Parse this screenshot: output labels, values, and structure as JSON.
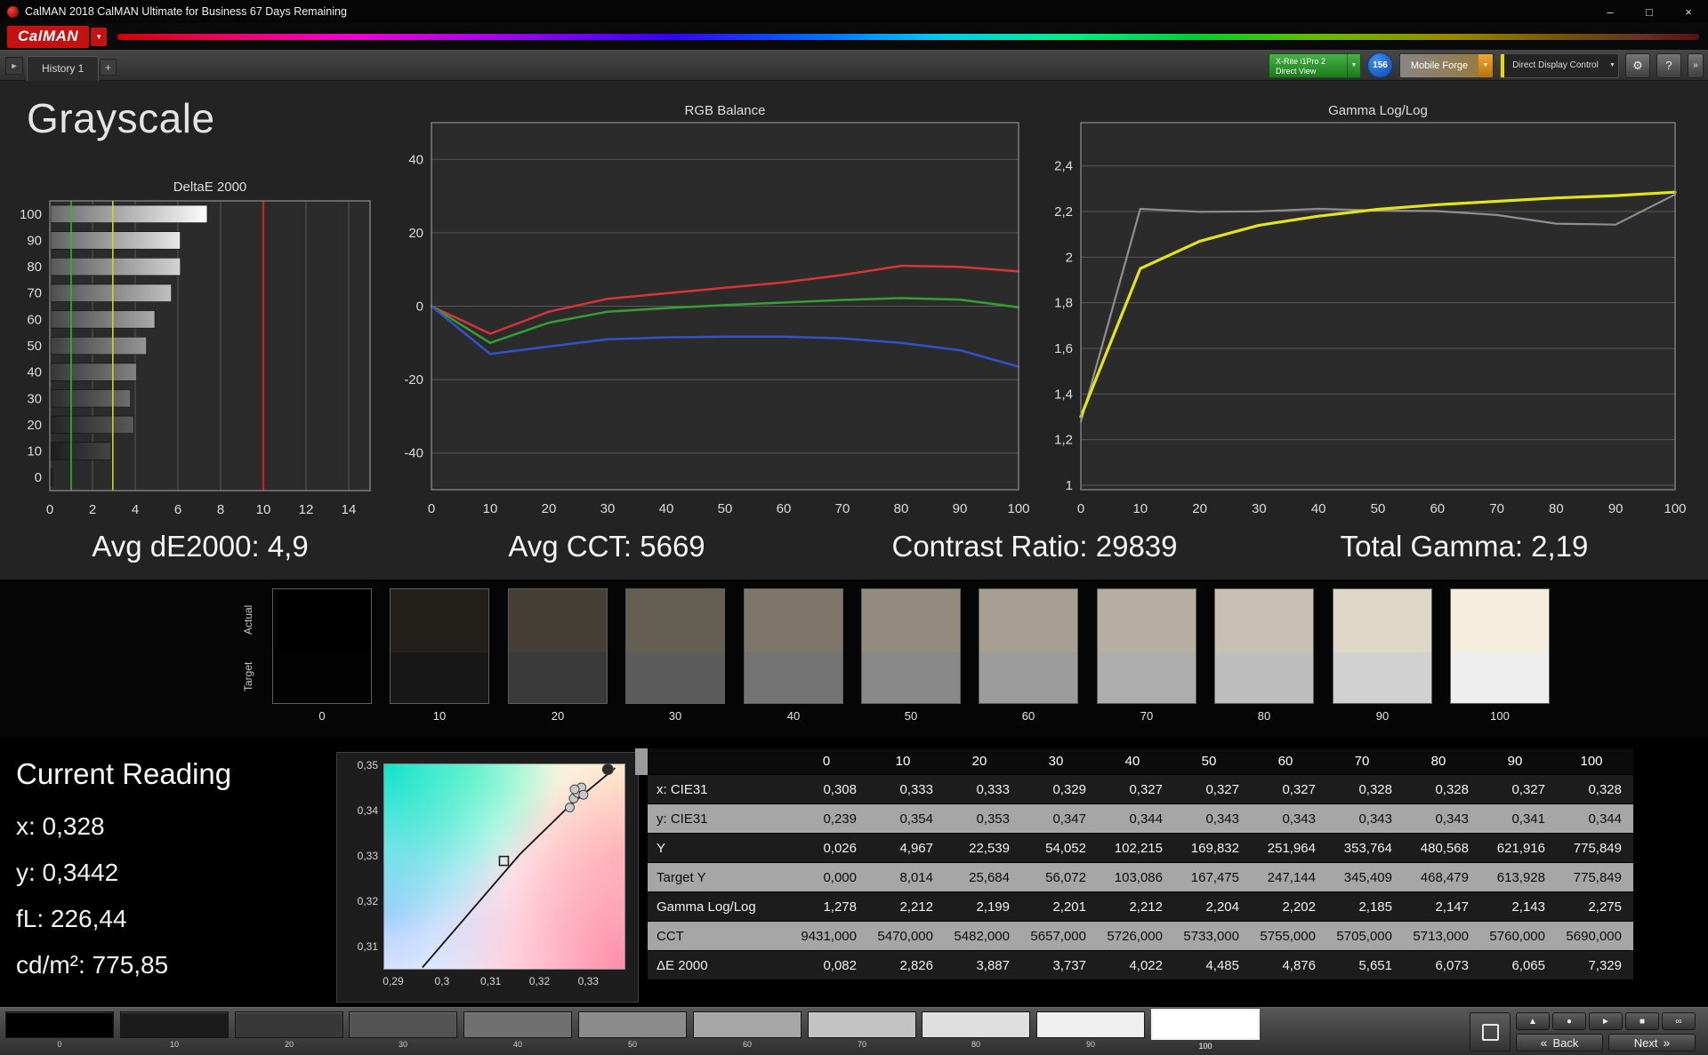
{
  "window": {
    "title": "CalMAN 2018 CalMAN Ultimate for Business 67 Days Remaining"
  },
  "icons": {
    "dropdown": "▼",
    "logo_arrow": "▼",
    "minimize": "–",
    "maximize": "□",
    "close": "×",
    "gear": "⚙",
    "help": "?",
    "plus": "+",
    "tab_nav": "►",
    "back_arrow": "«",
    "next_arrow": "»",
    "eject": "▲",
    "record": "●",
    "play": "►",
    "save": "■",
    "loop": "∞"
  },
  "logo": {
    "text": "CalMAN"
  },
  "toolbar": {
    "history_tab": "History 1",
    "meter_line1": "X-Rite i1Pro 2",
    "meter_line2": "Direct View",
    "badge": "156",
    "workflow": "Mobile Forge",
    "display_control": "Direct Display Control"
  },
  "page": {
    "title": "Grayscale"
  },
  "stats": [
    "Avg dE2000: 4,9",
    "Avg CCT: 5669",
    "Contrast Ratio: 29839",
    "Total Gamma: 2,19"
  ],
  "grayscale_patches": {
    "actual_label": "Actual",
    "target_label": "Target",
    "items": [
      {
        "label": "0",
        "actual": "#000000",
        "target": "#030303"
      },
      {
        "label": "10",
        "actual": "#231f1a",
        "target": "#181818"
      },
      {
        "label": "20",
        "actual": "#453f36",
        "target": "#3a3a3a"
      },
      {
        "label": "30",
        "actual": "#655e52",
        "target": "#5c5c5c"
      },
      {
        "label": "40",
        "actual": "#7d7669",
        "target": "#737373"
      },
      {
        "label": "50",
        "actual": "#948c7f",
        "target": "#898989"
      },
      {
        "label": "60",
        "actual": "#a69e91",
        "target": "#9c9c9c"
      },
      {
        "label": "70",
        "actual": "#b7afa2",
        "target": "#adadad"
      },
      {
        "label": "80",
        "actual": "#c8c0b3",
        "target": "#bebebe"
      },
      {
        "label": "90",
        "actual": "#ded6c7",
        "target": "#d1d1d1"
      },
      {
        "label": "100",
        "actual": "#f6eedd",
        "target": "#eeeeee"
      }
    ]
  },
  "current_reading": {
    "title": "Current Reading",
    "lines": [
      "x: 0,328",
      "y: 0,3442",
      "fL: 226,44",
      "cd/m²: 775,85"
    ]
  },
  "table": {
    "columns": [
      "0",
      "10",
      "20",
      "30",
      "40",
      "50",
      "60",
      "70",
      "80",
      "90",
      "100"
    ],
    "rows": [
      {
        "label": "x: CIE31",
        "light": false,
        "values": [
          "0,308",
          "0,333",
          "0,333",
          "0,329",
          "0,327",
          "0,327",
          "0,327",
          "0,328",
          "0,328",
          "0,327",
          "0,328"
        ]
      },
      {
        "label": "y: CIE31",
        "light": true,
        "values": [
          "0,239",
          "0,354",
          "0,353",
          "0,347",
          "0,344",
          "0,343",
          "0,343",
          "0,343",
          "0,343",
          "0,341",
          "0,344"
        ]
      },
      {
        "label": "Y",
        "light": false,
        "values": [
          "0,026",
          "4,967",
          "22,539",
          "54,052",
          "102,215",
          "169,832",
          "251,964",
          "353,764",
          "480,568",
          "621,916",
          "775,849"
        ]
      },
      {
        "label": "Target Y",
        "light": true,
        "values": [
          "0,000",
          "8,014",
          "25,684",
          "56,072",
          "103,086",
          "167,475",
          "247,144",
          "345,409",
          "468,479",
          "613,928",
          "775,849"
        ]
      },
      {
        "label": "Gamma Log/Log",
        "light": false,
        "values": [
          "1,278",
          "2,212",
          "2,199",
          "2,201",
          "2,212",
          "2,204",
          "2,202",
          "2,185",
          "2,147",
          "2,143",
          "2,275"
        ]
      },
      {
        "label": "CCT",
        "light": true,
        "values": [
          "9431,000",
          "5470,000",
          "5482,000",
          "5657,000",
          "5726,000",
          "5733,000",
          "5755,000",
          "5705,000",
          "5713,000",
          "5760,000",
          "5690,000"
        ]
      },
      {
        "label": "ΔE 2000",
        "light": false,
        "values": [
          "0,082",
          "2,826",
          "3,887",
          "3,737",
          "4,022",
          "4,485",
          "4,876",
          "5,651",
          "6,073",
          "6,065",
          "7,329"
        ]
      }
    ]
  },
  "bottom_bar": {
    "back_label": "Back",
    "next_label": "Next",
    "swatches": [
      {
        "label": "0",
        "color": "#000000",
        "selected": false
      },
      {
        "label": "10",
        "color": "#1b1b1b",
        "selected": false
      },
      {
        "label": "20",
        "color": "#373737",
        "selected": false
      },
      {
        "label": "30",
        "color": "#535353",
        "selected": false
      },
      {
        "label": "40",
        "color": "#6f6f6f",
        "selected": false
      },
      {
        "label": "50",
        "color": "#8b8b8b",
        "selected": false
      },
      {
        "label": "60",
        "color": "#a7a7a7",
        "selected": false
      },
      {
        "label": "70",
        "color": "#c3c3c3",
        "selected": false
      },
      {
        "label": "80",
        "color": "#dfdfdf",
        "selected": false
      },
      {
        "label": "90",
        "color": "#efefef",
        "selected": false
      },
      {
        "label": "100",
        "color": "#ffffff",
        "selected": true
      }
    ]
  },
  "colors": {
    "brand_red": "#c41212",
    "ref_green": "#2db82d",
    "ref_yellow": "#d4d41e",
    "ref_red": "#c42222",
    "series_red": "#d83434",
    "series_green": "#33a033",
    "series_blue": "#3352cc",
    "gamma_yellow": "#e4e41c",
    "gamma_gray": "#8f8f8f",
    "meter_green": "#2e8f2e",
    "badge_blue": "#1766d8",
    "workflow_orange": "#d08a20",
    "control_yellow": "#ead800"
  },
  "chart_data": [
    {
      "id": "deltae",
      "type": "bar",
      "title": "DeltaE 2000",
      "orientation": "horizontal",
      "categories": [
        "100",
        "90",
        "80",
        "70",
        "60",
        "50",
        "40",
        "30",
        "20",
        "10",
        "0"
      ],
      "values": [
        7.329,
        6.065,
        6.073,
        5.651,
        4.876,
        4.485,
        4.022,
        3.737,
        3.887,
        2.826,
        0.082
      ],
      "bar_levels": [
        100,
        90,
        80,
        70,
        60,
        50,
        40,
        30,
        20,
        10,
        0
      ],
      "xlim": [
        0,
        15
      ],
      "xtick_values": [
        0,
        2,
        4,
        6,
        8,
        10,
        12,
        14
      ],
      "xtick_labels": [
        "0",
        "2",
        "4",
        "6",
        "8",
        "10",
        "12",
        "14"
      ],
      "reference_lines": [
        {
          "value": 1,
          "color": "#2db82d"
        },
        {
          "value": 2.95,
          "color": "#d4d41e"
        },
        {
          "value": 10,
          "color": "#c42222"
        }
      ]
    },
    {
      "id": "rgb_balance",
      "type": "line",
      "title": "RGB Balance",
      "x": [
        0,
        10,
        20,
        30,
        40,
        50,
        60,
        70,
        80,
        90,
        100
      ],
      "xtick_labels": [
        "0",
        "10",
        "20",
        "30",
        "40",
        "50",
        "60",
        "70",
        "80",
        "90",
        "100"
      ],
      "ylim": [
        -50,
        50
      ],
      "ytick_values": [
        40,
        20,
        0,
        -20,
        -40
      ],
      "ytick_labels": [
        "40",
        "20",
        "0",
        "-20",
        "-40"
      ],
      "series": [
        {
          "name": "Red",
          "color": "#d83434",
          "width": 2.5,
          "values": [
            0,
            -7.5,
            -1.5,
            2,
            3.5,
            5,
            6.5,
            8.5,
            11,
            10.7,
            9.5
          ]
        },
        {
          "name": "Green",
          "color": "#33a033",
          "width": 2.5,
          "values": [
            0,
            -10,
            -4.5,
            -1.5,
            -0.5,
            0.3,
            1,
            1.7,
            2.2,
            1.8,
            -0.3
          ]
        },
        {
          "name": "Blue",
          "color": "#3352cc",
          "width": 2.5,
          "values": [
            0,
            -13,
            -11,
            -9,
            -8.5,
            -8.3,
            -8.3,
            -8.8,
            -10,
            -12,
            -16.5
          ]
        }
      ]
    },
    {
      "id": "gamma",
      "type": "line",
      "title": "Gamma Log/Log",
      "x": [
        0,
        10,
        20,
        30,
        40,
        50,
        60,
        70,
        80,
        90,
        100
      ],
      "xtick_labels": [
        "0",
        "10",
        "20",
        "30",
        "40",
        "50",
        "60",
        "70",
        "80",
        "90",
        "100"
      ],
      "ylim": [
        0.98,
        2.59
      ],
      "ytick_values": [
        2.4,
        2.2,
        2,
        1.8,
        1.6,
        1.4,
        1.2,
        1
      ],
      "ytick_labels": [
        "2,4",
        "2,2",
        "2",
        "1,8",
        "1,6",
        "1,4",
        "1,2",
        "1"
      ],
      "series": [
        {
          "name": "Gamma Measured",
          "color": "#8f8f8f",
          "width": 2.2,
          "values": [
            1.278,
            2.212,
            2.199,
            2.201,
            2.212,
            2.204,
            2.202,
            2.185,
            2.147,
            2.143,
            2.275
          ]
        },
        {
          "name": "Gamma Smoothed",
          "color": "#e4e41c",
          "width": 3.2,
          "values": [
            1.3,
            1.95,
            2.07,
            2.14,
            2.18,
            2.21,
            2.23,
            2.245,
            2.26,
            2.27,
            2.285
          ]
        }
      ]
    },
    {
      "id": "cie",
      "type": "scatter",
      "title": "CIE 1931 Chromaticity",
      "xlim": [
        0.288,
        0.3376
      ],
      "ylim": [
        0.305,
        0.3505
      ],
      "xtick_values": [
        0.29,
        0.3,
        0.31,
        0.32,
        0.33
      ],
      "xtick_labels": [
        "0,29",
        "0,3",
        "0,31",
        "0,32",
        "0,33"
      ],
      "ytick_values": [
        0.35,
        0.34,
        0.33,
        0.32,
        0.31
      ],
      "ytick_labels": [
        "0,35",
        "0,34",
        "0,33",
        "0,32",
        "0,31"
      ],
      "locus": [
        [
          0.296,
          0.3055
        ],
        [
          0.306,
          0.318
        ],
        [
          0.316,
          0.3305
        ],
        [
          0.326,
          0.341
        ],
        [
          0.3355,
          0.3495
        ]
      ],
      "target_square": {
        "x": 0.3127,
        "y": 0.329
      },
      "points": [
        {
          "x": 0.3262,
          "y": 0.3408,
          "dark": false
        },
        {
          "x": 0.327,
          "y": 0.3428,
          "dark": false
        },
        {
          "x": 0.3278,
          "y": 0.344,
          "dark": false
        },
        {
          "x": 0.3286,
          "y": 0.3452,
          "dark": false
        },
        {
          "x": 0.3272,
          "y": 0.3448,
          "dark": false
        },
        {
          "x": 0.329,
          "y": 0.3436,
          "dark": false
        },
        {
          "x": 0.334,
          "y": 0.3492,
          "dark": true
        }
      ]
    }
  ]
}
